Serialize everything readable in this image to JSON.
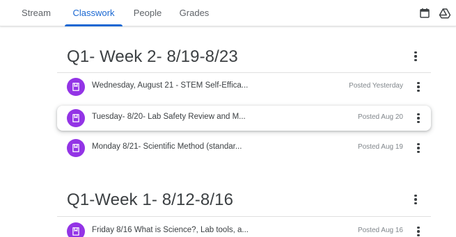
{
  "nav": {
    "tabs": [
      {
        "label": "Stream"
      },
      {
        "label": "Classwork"
      },
      {
        "label": "People"
      },
      {
        "label": "Grades"
      }
    ],
    "icons": [
      "calendar-icon",
      "google-drive-icon"
    ],
    "accent_color": "#1967d2"
  },
  "sections": [
    {
      "title": "Q1- Week 2- 8/19-8/23",
      "items": [
        {
          "title": "Wednesday, August 21 - STEM Self-Effica...",
          "date": "Posted Yesterday"
        },
        {
          "title": "Tuesday- 8/20- Lab Safety Review and M...",
          "date": "Posted Aug 20"
        },
        {
          "title": "Monday 8/21- Scientific Method (standar...",
          "date": "Posted Aug 19"
        }
      ]
    },
    {
      "title": "Q1-Week 1- 8/12-8/16",
      "items": [
        {
          "title": "Friday 8/16 What is Science?, Lab tools, a...",
          "date": "Posted Aug 16"
        }
      ]
    }
  ],
  "assignment_icon_color": "#9334e6"
}
